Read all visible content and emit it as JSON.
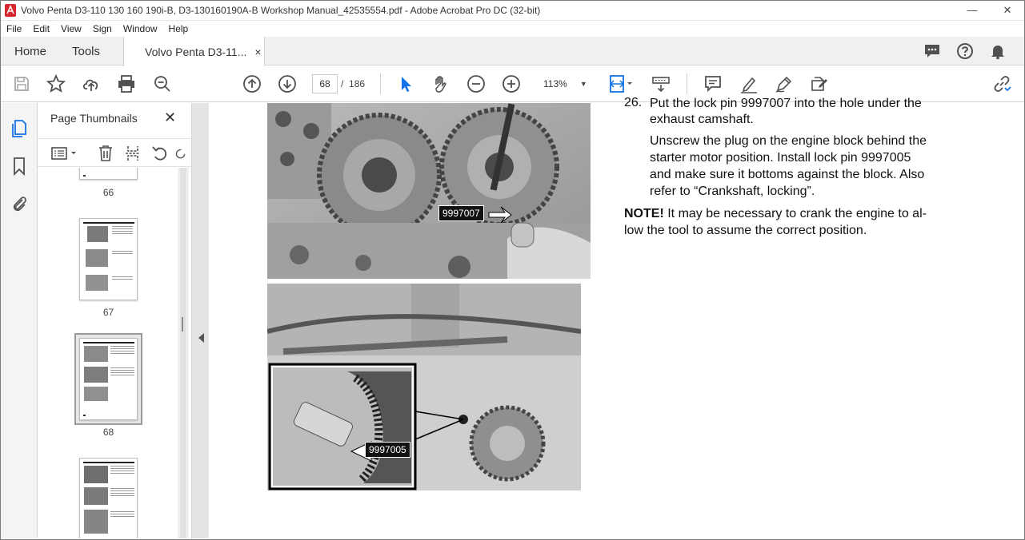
{
  "window": {
    "title": "Volvo Penta D3-110 130 160 190i-B, D3-130160190A-B Workshop Manual_42535554.pdf - Adobe Acrobat Pro DC (32-bit)",
    "minimize": "—",
    "close": "✕"
  },
  "menu": [
    "File",
    "Edit",
    "View",
    "Sign",
    "Window",
    "Help"
  ],
  "tabs": {
    "home": "Home",
    "tools": "Tools",
    "document": "Volvo Penta D3-11...",
    "close": "×"
  },
  "toolbar": {
    "current_page": "68",
    "page_separator": "/",
    "total_pages": "186",
    "zoom": "113%"
  },
  "thumbnails_panel": {
    "title": "Page Thumbnails",
    "close": "✕",
    "pages": [
      "66",
      "67",
      "68"
    ],
    "selected_page": "68"
  },
  "document": {
    "step_number": "26.",
    "step_line1": "Put the lock pin 9997007 into the hole under the",
    "step_line2": "exhaust camshaft.",
    "para2_line1": "Unscrew the plug on the engine block behind the",
    "para2_line2": "starter motor position. Install lock pin 9997005",
    "para2_line3": "and make sure it bottoms against the block. Also",
    "para2_line4": "refer to “Crankshaft, locking”.",
    "note_label": "NOTE!",
    "note_line1": " It may be necessary to crank the engine to al-",
    "note_line2": "low the tool to assume the correct position.",
    "callout_top": "9997007",
    "callout_bottom": "9997005"
  },
  "colors": {
    "accent_blue": "#1473e6",
    "icon_gray": "#505050",
    "acrobat_red": "#d7282f"
  }
}
